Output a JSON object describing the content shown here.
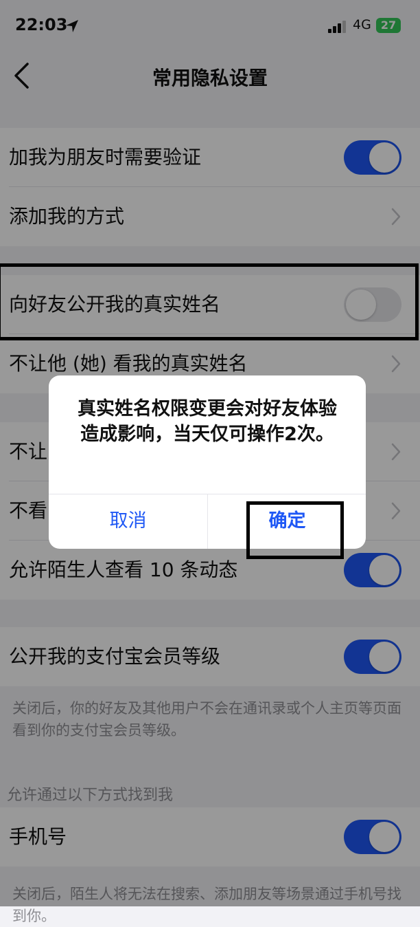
{
  "status_bar": {
    "time": "22:03",
    "network": "4G",
    "battery": "27"
  },
  "nav": {
    "title": "常用隐私设置"
  },
  "group1": [
    {
      "label": "加我为朋友时需要验证",
      "control": "toggle",
      "on": true
    },
    {
      "label": "添加我的方式",
      "control": "chevron"
    }
  ],
  "group2": [
    {
      "label": "向好友公开我的真实姓名",
      "control": "toggle",
      "on": false
    },
    {
      "label": "不让他 (她) 看我的真实姓名",
      "control": "chevron"
    }
  ],
  "group3": [
    {
      "label": "不让",
      "control": "chevron"
    },
    {
      "label": "不看",
      "control": "chevron"
    },
    {
      "label": "允许陌生人查看 10 条动态",
      "control": "toggle",
      "on": true
    }
  ],
  "group4": [
    {
      "label": "公开我的支付宝会员等级",
      "control": "toggle",
      "on": true
    }
  ],
  "group4_note": "关闭后，你的好友及其他用户不会在通讯录或个人主页等页面看到你的支付宝会员等级。",
  "find_me_header": "允许通过以下方式找到我",
  "group5": [
    {
      "label": "手机号",
      "control": "toggle",
      "on": true
    }
  ],
  "group5_note": "关闭后，陌生人将无法在搜索、添加朋友等场景通过手机号找到你。",
  "dialog": {
    "message": "真实姓名权限变更会对好友体验造成影响，当天仅可操作2次。",
    "cancel_label": "取消",
    "confirm_label": "确定"
  },
  "colors": {
    "accent": "#1f58f5",
    "toggle_off": "#e4e4e8",
    "overlay": "rgba(0,0,0,0.40)"
  }
}
